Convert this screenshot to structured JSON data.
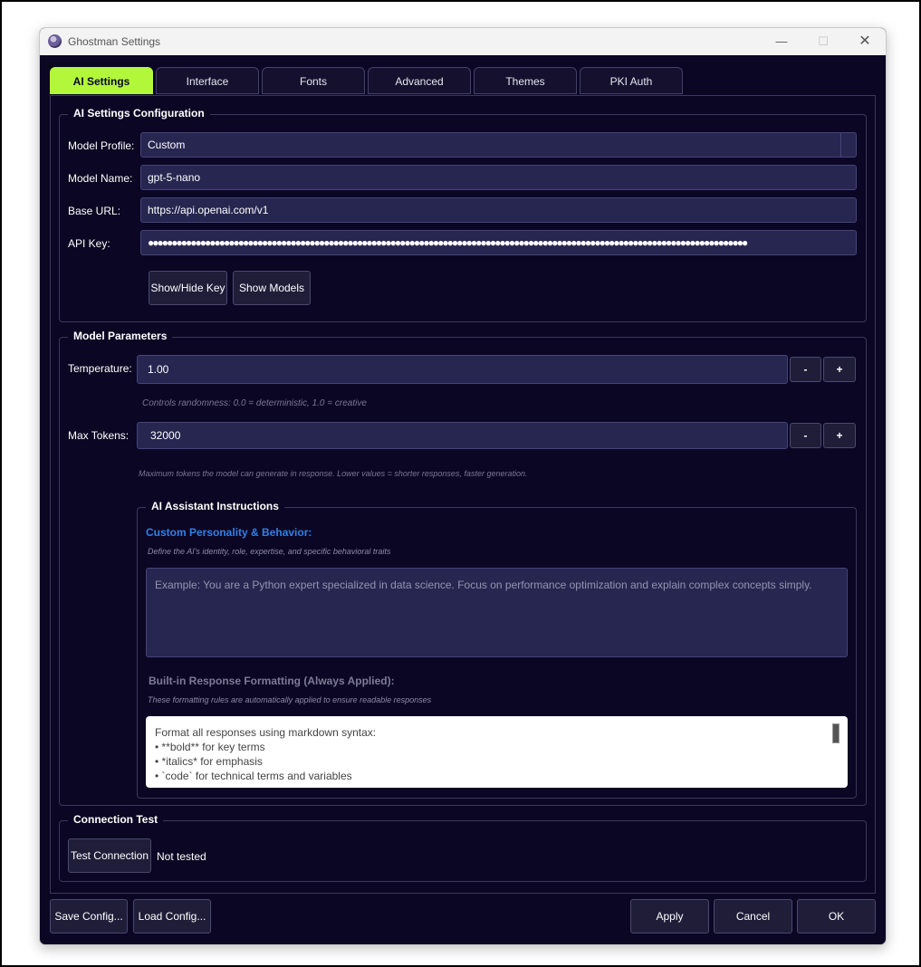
{
  "window": {
    "title": "Ghostman Settings",
    "controls": {
      "minimize": "—",
      "maximize": "☐",
      "close": "✕"
    }
  },
  "tabs": [
    {
      "label": "AI Settings",
      "active": true
    },
    {
      "label": "Interface"
    },
    {
      "label": "Fonts"
    },
    {
      "label": "Advanced"
    },
    {
      "label": "Themes"
    },
    {
      "label": "PKI Auth"
    }
  ],
  "ai_config": {
    "group_title": "AI Settings Configuration",
    "model_profile_label": "Model Profile:",
    "model_profile_value": "Custom",
    "model_name_label": "Model Name:",
    "model_name_value": "gpt-5-nano",
    "base_url_label": "Base URL:",
    "base_url_value": "https://api.openai.com/v1",
    "api_key_label": "API Key:",
    "api_key_value": "●●●●●●●●●●●●●●●●●●●●●●●●●●●●●●●●●●●●●●●●●●●●●●●●●●●●●●●●●●●●●●●●●●●●●●●●●●●●●●●●●●●●●●●●●●●●●●●●●●●●●●●●●●●●●●●●●●●●●●●●●●●●●●",
    "show_hide_key_button": "Show/Hide Key",
    "show_models_button": "Show Models"
  },
  "model_params": {
    "group_title": "Model Parameters",
    "temperature_label": "Temperature:",
    "temperature_value": "1.00",
    "temperature_hint": "Controls randomness: 0.0 = deterministic, 1.0 = creative",
    "max_tokens_label": "Max Tokens:",
    "max_tokens_value": "32000",
    "max_tokens_hint": "Maximum tokens the model can generate in response. Lower values = shorter responses, faster generation.",
    "minus": "-",
    "plus": "+"
  },
  "instructions": {
    "group_title": "AI Assistant Instructions",
    "custom_heading": "Custom Personality & Behavior:",
    "custom_hint": "Define the AI's identity, role, expertise, and specific behavioral traits",
    "custom_placeholder": "Example: You are a Python expert specialized in data science. Focus on performance optimization and explain complex concepts simply.",
    "builtin_heading": "Built-in Response Formatting (Always Applied):",
    "builtin_hint": "These formatting rules are automatically applied to ensure readable responses",
    "builtin_lines": [
      "Format all responses using markdown syntax:",
      "• **bold** for key terms",
      "• *italics* for emphasis",
      "• `code` for technical terms and variables"
    ]
  },
  "connection": {
    "group_title": "Connection Test",
    "test_button": "Test Connection",
    "status": "Not tested"
  },
  "footer": {
    "save_config": "Save Config...",
    "load_config": "Load Config...",
    "apply": "Apply",
    "cancel": "Cancel",
    "ok": "OK"
  },
  "colors": {
    "background": "#0b0623",
    "active_tab": "#b2f73a",
    "field": "#262650",
    "accent_blue": "#2f80e8"
  }
}
